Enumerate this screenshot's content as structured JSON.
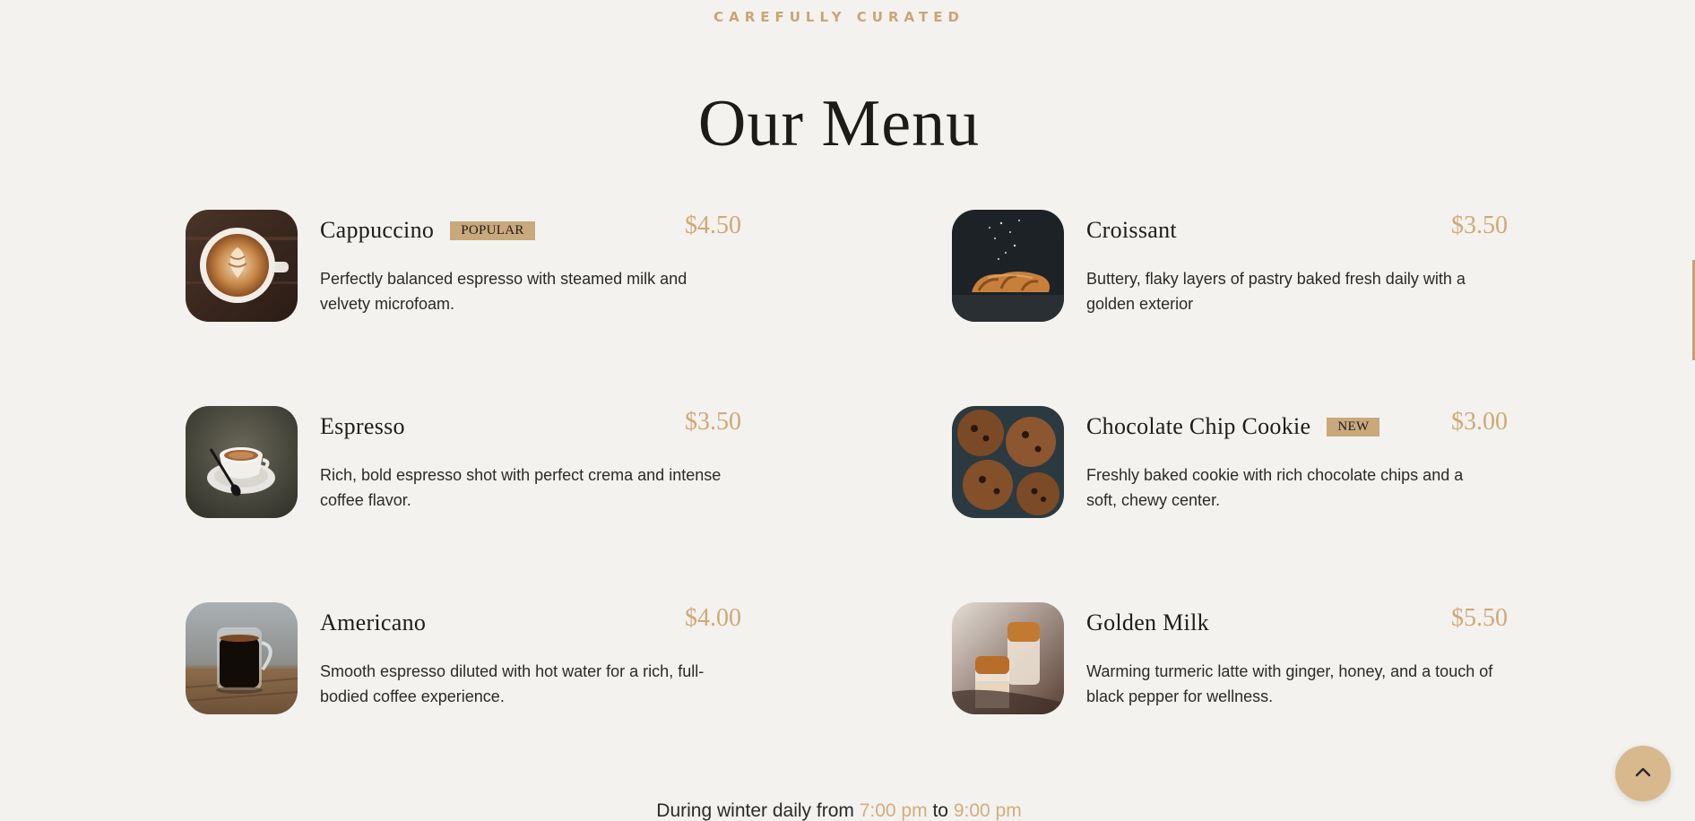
{
  "header": {
    "eyebrow": "CAREFULLY CURATED",
    "title": "Our Menu"
  },
  "menu": {
    "left": [
      {
        "name": "Cappuccino",
        "badge": "POPULAR",
        "price": "$4.50",
        "description": "Perfectly balanced espresso with steamed milk and velvety microfoam.",
        "image": "cappuccino-photo"
      },
      {
        "name": "Espresso",
        "badge": "",
        "price": "$3.50",
        "description": "Rich, bold espresso shot with perfect crema and intense coffee flavor.",
        "image": "espresso-photo"
      },
      {
        "name": "Americano",
        "badge": "",
        "price": "$4.00",
        "description": "Smooth espresso diluted with hot water for a rich, full-bodied coffee experience.",
        "image": "americano-photo"
      }
    ],
    "right": [
      {
        "name": "Croissant",
        "badge": "",
        "price": "$3.50",
        "description": "Buttery, flaky layers of pastry baked fresh daily with a golden exterior",
        "image": "croissant-photo"
      },
      {
        "name": "Chocolate Chip Cookie",
        "badge": "NEW",
        "price": "$3.00",
        "description": "Freshly baked cookie with rich chocolate chips and a soft, chewy center.",
        "image": "cookie-photo"
      },
      {
        "name": "Golden Milk",
        "badge": "",
        "price": "$5.50",
        "description": "Warming turmeric latte with ginger, honey, and a touch of black pepper for wellness.",
        "image": "golden-milk-photo"
      }
    ]
  },
  "hours": {
    "prefix": "During winter daily from",
    "open": "7:00 pm",
    "connector": "to",
    "close": "9:00 pm"
  },
  "scroll_top": {
    "icon": "chevron-up-icon"
  },
  "colors": {
    "background": "#f4f2ef",
    "accent": "#cfa977",
    "badge": "#c9a87c",
    "text": "#1c1c1c"
  }
}
